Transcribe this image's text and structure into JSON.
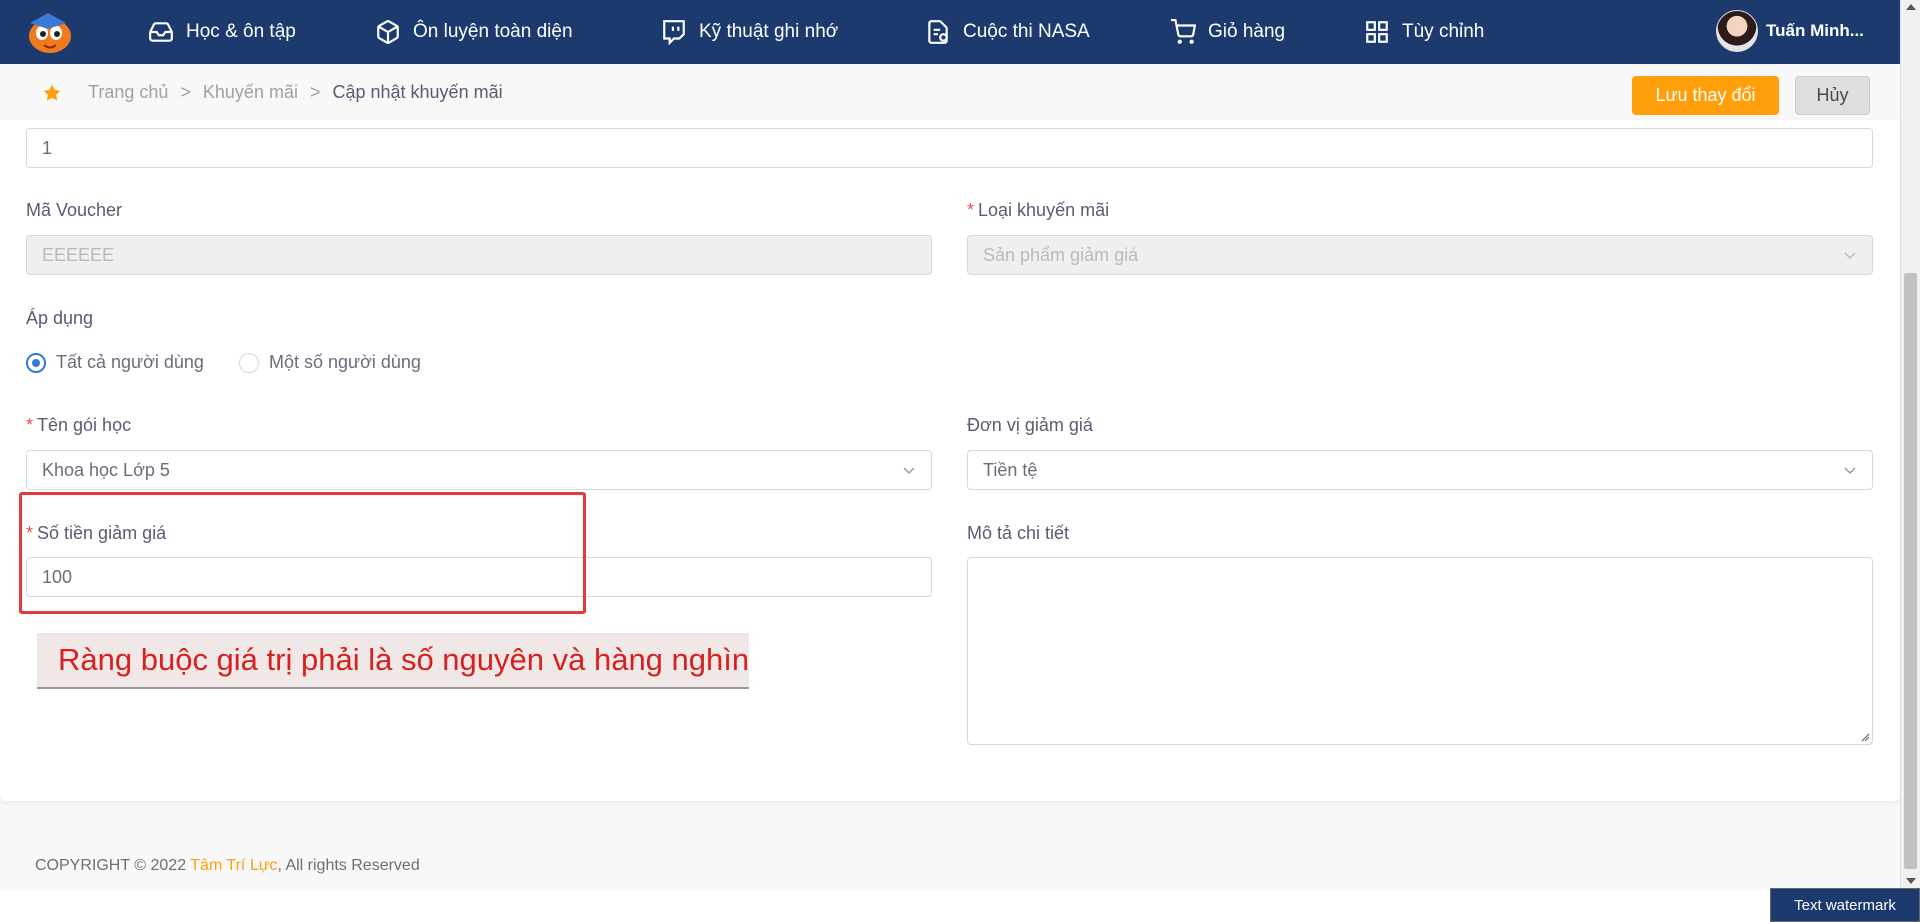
{
  "nav": {
    "items": [
      {
        "label": "Học & ôn tập",
        "icon": "inbox-icon"
      },
      {
        "label": "Ôn luyện toàn diện",
        "icon": "cube-icon"
      },
      {
        "label": "Kỹ thuật ghi nhớ",
        "icon": "twitch-icon"
      },
      {
        "label": "Cuộc thi NASA",
        "icon": "file-check-icon"
      },
      {
        "label": "Giỏ hàng",
        "icon": "cart-icon"
      },
      {
        "label": "Tùy chỉnh",
        "icon": "grid-icon"
      }
    ],
    "user_name": "Tuấn Minh..."
  },
  "breadcrumb": {
    "home": "Trang chủ",
    "sep": ">",
    "parent": "Khuyến mãi",
    "current": "Cập nhật khuyến mãi"
  },
  "actions": {
    "save": "Lưu thay đổi",
    "cancel": "Hủy"
  },
  "form": {
    "top_value": "1",
    "voucher": {
      "label": "Mã Voucher",
      "value": "EEEEEE"
    },
    "promo_type": {
      "label": "Loại khuyến mãi",
      "value": "Sản phẩm giảm giá"
    },
    "apply": {
      "label": "Áp dụng",
      "options": [
        "Tất cả người dùng",
        "Một số người dùng"
      ],
      "selected": "Tất cả người dùng"
    },
    "package": {
      "label": "Tên gói học",
      "value": "Khoa học Lớp 5"
    },
    "discount_unit": {
      "label": "Đơn vị giảm giá",
      "value": "Tiền tệ"
    },
    "discount_amount": {
      "label": "Số tiền giảm giá",
      "value": "100"
    },
    "description": {
      "label": "Mô tả chi tiết",
      "value": ""
    },
    "required_mark": "*"
  },
  "annotation": {
    "text": "Ràng buộc giá trị phải là số nguyên và hàng nghìn"
  },
  "footer": {
    "prefix": "COPYRIGHT © 2022 ",
    "brand": "Tâm Trí Lực",
    "suffix": ", All rights Reserved"
  },
  "watermark": "Text watermark",
  "colors": {
    "nav_bg": "#1c3a6e",
    "accent": "#ff9f0b",
    "required": "#ea5455",
    "annotation_red": "#d82020",
    "radio_on": "#2f7bdc"
  }
}
